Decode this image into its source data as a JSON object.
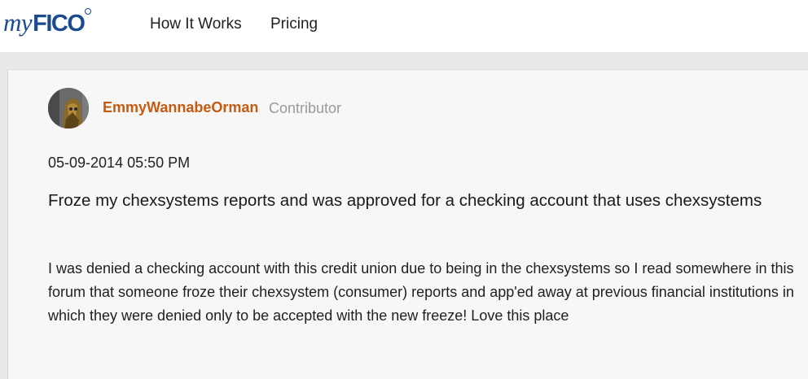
{
  "header": {
    "logo": {
      "prefix": "my",
      "brand": "FICO"
    },
    "nav": {
      "how_it_works": "How It Works",
      "pricing": "Pricing"
    }
  },
  "post": {
    "author": {
      "name": "EmmyWannabeOrman",
      "rank": "Contributor"
    },
    "date": "05-09-2014 05:50 PM",
    "subject": "Froze my chexsystems reports and was approved for a checking account that uses chexsystems",
    "body": "I was denied a checking account with this credit union due to being in the chexsystems so I read somewhere in this forum that someone froze their chexsystem (consumer) reports and app'ed away at previous financial institutions in which they were denied only to be accepted with the new freeze! Love this place"
  },
  "colors": {
    "brand_blue": "#1b4a8e",
    "author_orange": "#c55a11",
    "rank_gray": "#9a9a9a",
    "page_background": "#e9e9e9",
    "card_background": "#f7f7f7"
  },
  "icons": {
    "avatar": "user-avatar-image"
  }
}
